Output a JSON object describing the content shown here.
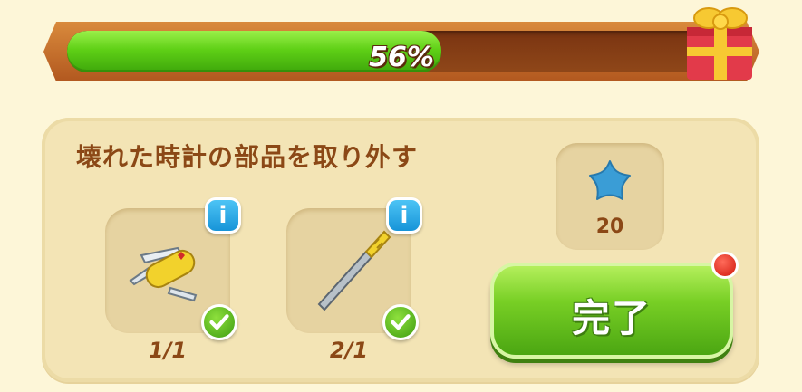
{
  "progress": {
    "value": 0.56,
    "label": "56%"
  },
  "reward_icon": "gift-box-icon",
  "quest": {
    "title": "壊れた時計の部品を取り外す",
    "items": [
      {
        "icon": "pocket-knife-icon",
        "count": "1/1",
        "info": "i",
        "completed": true
      },
      {
        "icon": "metal-file-icon",
        "count": "2/1",
        "info": "i",
        "completed": true
      }
    ],
    "reward": {
      "icon": "blue-star-icon",
      "amount": "20"
    },
    "complete_label": "完了"
  },
  "colors": {
    "title_brown": "#8b4816",
    "progress_green": "#5fd016",
    "button_green": "#78cf25",
    "info_blue": "#1794d8",
    "star_blue": "#3a9dd6",
    "notification_red": "#d0180c"
  }
}
